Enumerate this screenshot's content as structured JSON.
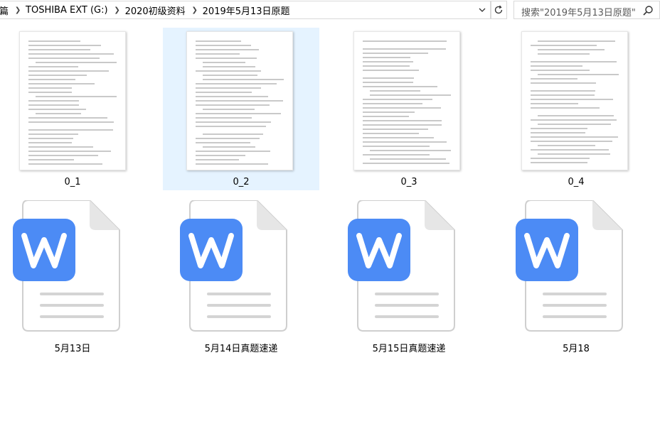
{
  "address": {
    "crumbs": [
      "篇",
      "TOSHIBA EXT (G:)",
      "2020初级资料",
      "2019年5月13日原题"
    ]
  },
  "search": {
    "placeholder": "搜索\"2019年5月13日原题\""
  },
  "files": [
    {
      "name": "0_1",
      "selected": false
    },
    {
      "name": "0_2",
      "selected": true
    },
    {
      "name": "0_3",
      "selected": false
    },
    {
      "name": "0_4",
      "selected": false
    }
  ],
  "docs": [
    {
      "name": "5月13日"
    },
    {
      "name": "5月14日真题速递"
    },
    {
      "name": "5月15日真题速递"
    },
    {
      "name": "5月18"
    }
  ],
  "colors": {
    "wps_blue": "#4c8bf5",
    "selection": "#e5f3ff"
  },
  "icons": [
    "chevron-right-icon",
    "chevron-down-icon",
    "refresh-icon",
    "search-icon",
    "wps-document-icon"
  ]
}
